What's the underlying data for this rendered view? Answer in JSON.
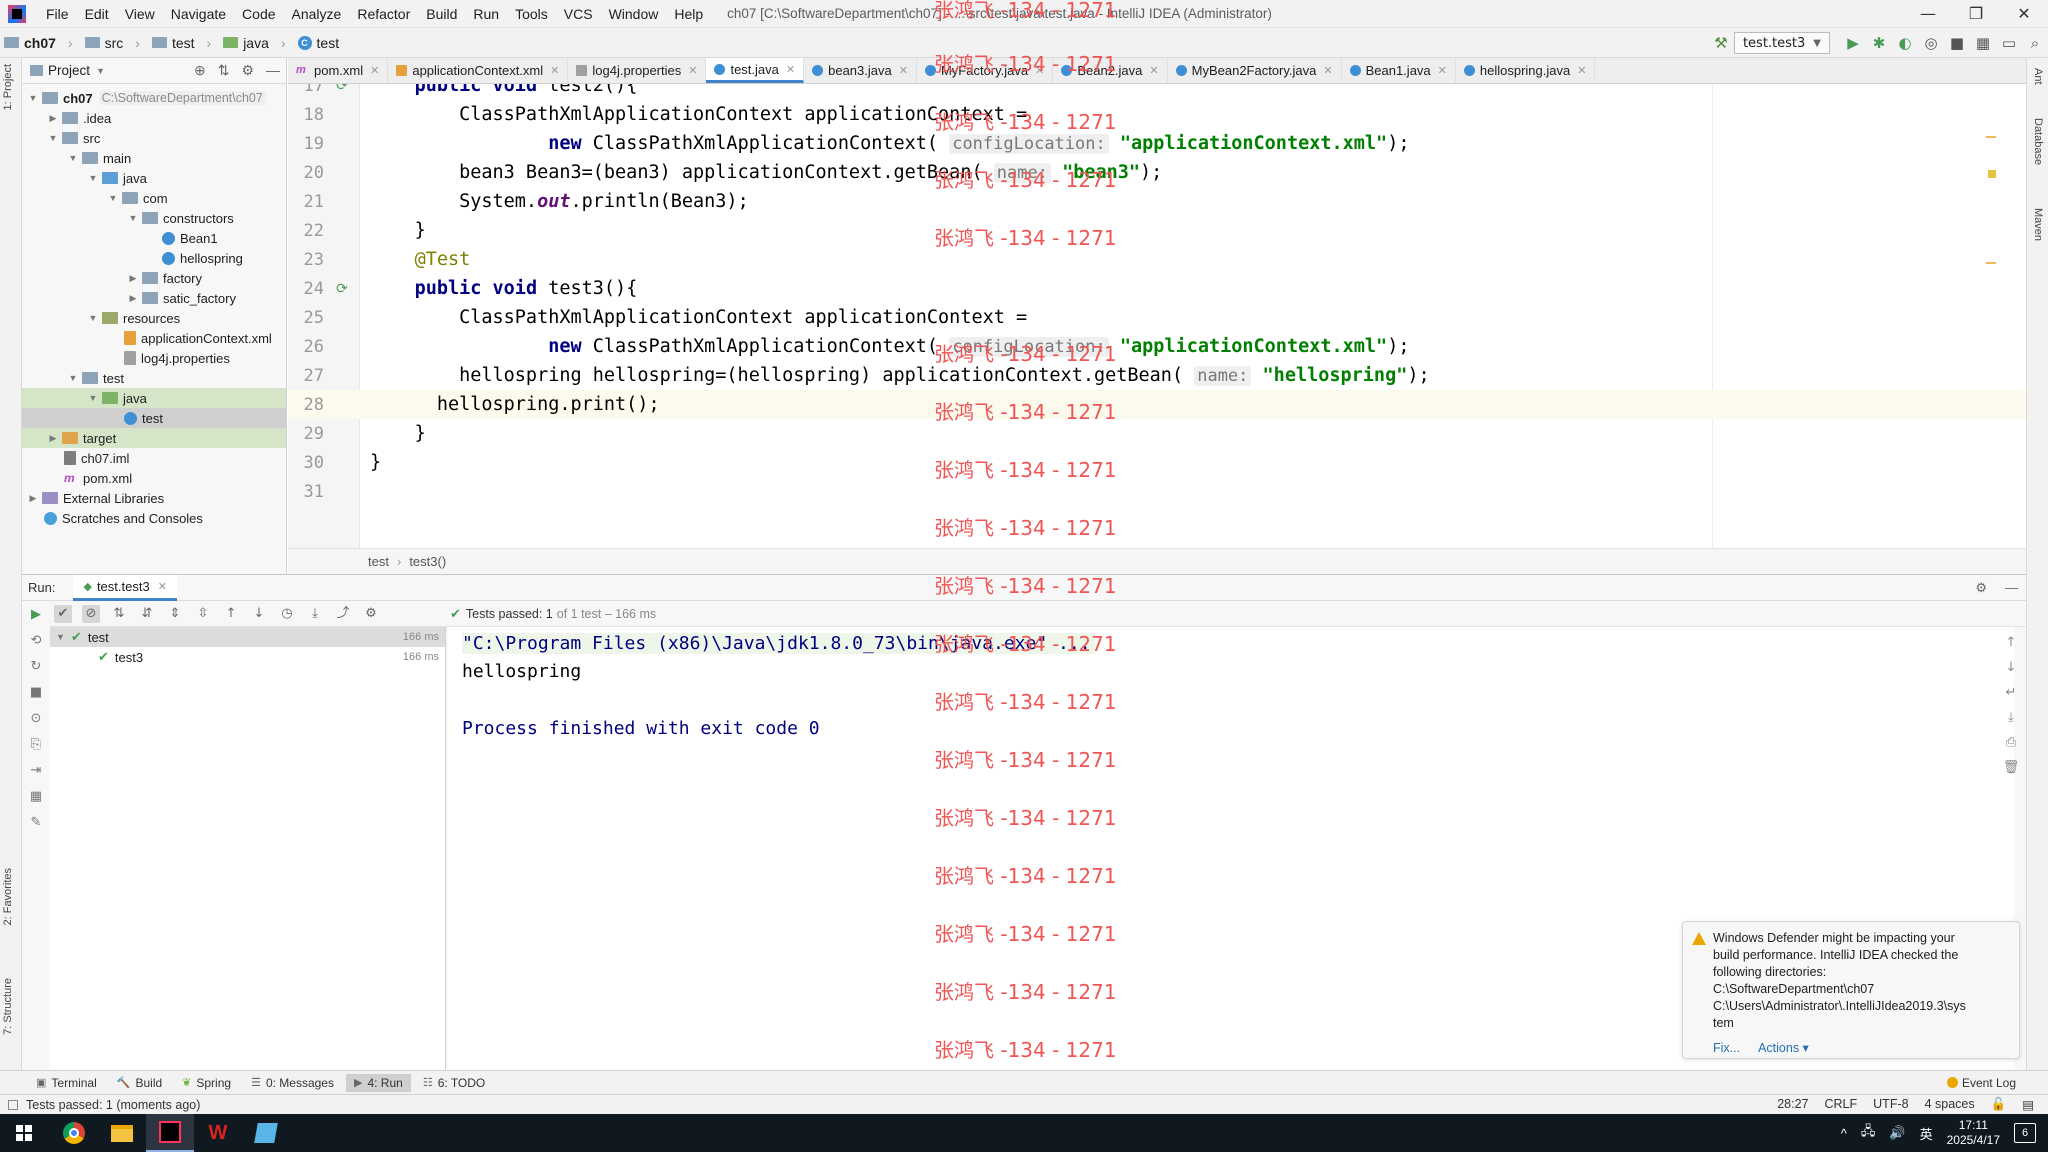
{
  "menubar": {
    "items": [
      "File",
      "Edit",
      "View",
      "Navigate",
      "Code",
      "Analyze",
      "Refactor",
      "Build",
      "Run",
      "Tools",
      "VCS",
      "Window",
      "Help"
    ],
    "window_title": "ch07 [C:\\SoftwareDepartment\\ch07] - ...\\src\\test\\java\\test.java - IntelliJ IDEA (Administrator)",
    "controls": [
      "—",
      "❐",
      "✕"
    ]
  },
  "navbar": {
    "crumbs": [
      "ch07",
      "src",
      "test",
      "java",
      "test"
    ],
    "run_config": "test.test3"
  },
  "left_strip": {
    "project": "1: Project",
    "favorites": "2: Favorites",
    "structure": "7: Structure"
  },
  "right_strip": {
    "ant": "Ant",
    "database": "Database",
    "maven": "Maven"
  },
  "project_panel": {
    "title": "Project",
    "tree": [
      {
        "label": "ch07",
        "hint": "C:\\SoftwareDepartment\\ch07"
      },
      {
        "label": ".idea"
      },
      {
        "label": "src"
      },
      {
        "label": "main"
      },
      {
        "label": "java"
      },
      {
        "label": "com"
      },
      {
        "label": "constructors"
      },
      {
        "label": "Bean1"
      },
      {
        "label": "hellospring"
      },
      {
        "label": "factory"
      },
      {
        "label": "satic_factory"
      },
      {
        "label": "resources"
      },
      {
        "label": "applicationContext.xml"
      },
      {
        "label": "log4j.properties"
      },
      {
        "label": "test"
      },
      {
        "label": "java"
      },
      {
        "label": "test"
      },
      {
        "label": "target"
      },
      {
        "label": "ch07.iml"
      },
      {
        "label": "pom.xml"
      },
      {
        "label": "External Libraries"
      },
      {
        "label": "Scratches and Consoles"
      }
    ]
  },
  "editor_tabs": [
    {
      "label": "pom.xml"
    },
    {
      "label": "applicationContext.xml"
    },
    {
      "label": "log4j.properties"
    },
    {
      "label": "test.java",
      "active": true
    },
    {
      "label": "bean3.java"
    },
    {
      "label": "MyFactory.java"
    },
    {
      "label": "Bean2.java"
    },
    {
      "label": "MyBean2Factory.java"
    },
    {
      "label": "Bean1.java"
    },
    {
      "label": "hellospring.java"
    }
  ],
  "editor": {
    "line_numbers": [
      "17",
      "18",
      "19",
      "20",
      "21",
      "22",
      "23",
      "24",
      "25",
      "26",
      "27",
      "28",
      "29",
      "30",
      "31"
    ],
    "code": {
      "l17_kw": "public void",
      "l17_rest": " test2(){",
      "l18": "ClassPathXmlApplicationContext applicationContext =",
      "l19_kw": "new",
      "l19_a": " ClassPathXmlApplicationContext(",
      "l19_hint": "configLocation:",
      "l19_str": "\"applicationContext.xml\"",
      "l19_end": ");",
      "l20_a": "bean3 Bean3=(bean3) applicationContext.getBean(",
      "l20_hint": "name:",
      "l20_str": "\"bean3\"",
      "l20_end": ");",
      "l21_a": "System.",
      "l21_field": "out",
      "l21_b": ".println(Bean3);",
      "l22": "}",
      "l23": "@Test",
      "l24_kw": "public void",
      "l24_rest": " test3(){",
      "l25": "ClassPathXmlApplicationContext applicationContext =",
      "l26_kw": "new",
      "l26_a": " ClassPathXmlApplicationContext(",
      "l26_hint": "configLocation:",
      "l26_str": "\"applicationContext.xml\"",
      "l26_end": ");",
      "l27_a": "hellospring hellospring=(hellospring) applicationContext.getBean(",
      "l27_hint": "name:",
      "l27_str": "\"hellospring\"",
      "l27_end": ");",
      "l28": "hellospring.print();",
      "l29": "}",
      "l30": "}"
    },
    "breadcrumb": [
      "test",
      "test3()"
    ]
  },
  "run_panel": {
    "label": "Run:",
    "tab": "test.test3",
    "status_main": "Tests passed: 1",
    "status_rest": "of 1 test – 166 ms",
    "tests": [
      {
        "name": "test",
        "time": "166 ms"
      },
      {
        "name": "test3",
        "time": "166 ms"
      }
    ],
    "console": {
      "cmd": "\"C:\\Program Files (x86)\\Java\\jdk1.8.0_73\\bin\\java.exe\" ...",
      "output": "hellospring",
      "process": "Process finished with exit code 0"
    }
  },
  "watermark": "张鸿飞 -134 - 1271",
  "notification": {
    "text_lines": [
      "Windows Defender might be impacting your",
      "build performance. IntelliJ IDEA checked the",
      "following directories:",
      "C:\\SoftwareDepartment\\ch07",
      "C:\\Users\\Administrator\\.IntelliJIdea2019.3\\sys",
      "tem"
    ],
    "fix": "Fix...",
    "actions": "Actions ▾"
  },
  "bottom_tabs": [
    {
      "label": "Terminal",
      "icon": "▣"
    },
    {
      "label": "Build",
      "icon": "🔨"
    },
    {
      "label": "Spring",
      "icon": "❦"
    },
    {
      "label": "0: Messages",
      "icon": "☰"
    },
    {
      "label": "4: Run",
      "icon": "▶",
      "active": true
    },
    {
      "label": "6: TODO",
      "icon": "☷"
    }
  ],
  "event_log": "Event Log",
  "statusbar": {
    "message": "Tests passed: 1 (moments ago)",
    "position": "28:27",
    "line_sep": "CRLF",
    "encoding": "UTF-8",
    "indent": "4 spaces"
  },
  "taskbar": {
    "ime": "英",
    "time": "17:11",
    "date": "2025/4/17",
    "notif_count": "6"
  }
}
